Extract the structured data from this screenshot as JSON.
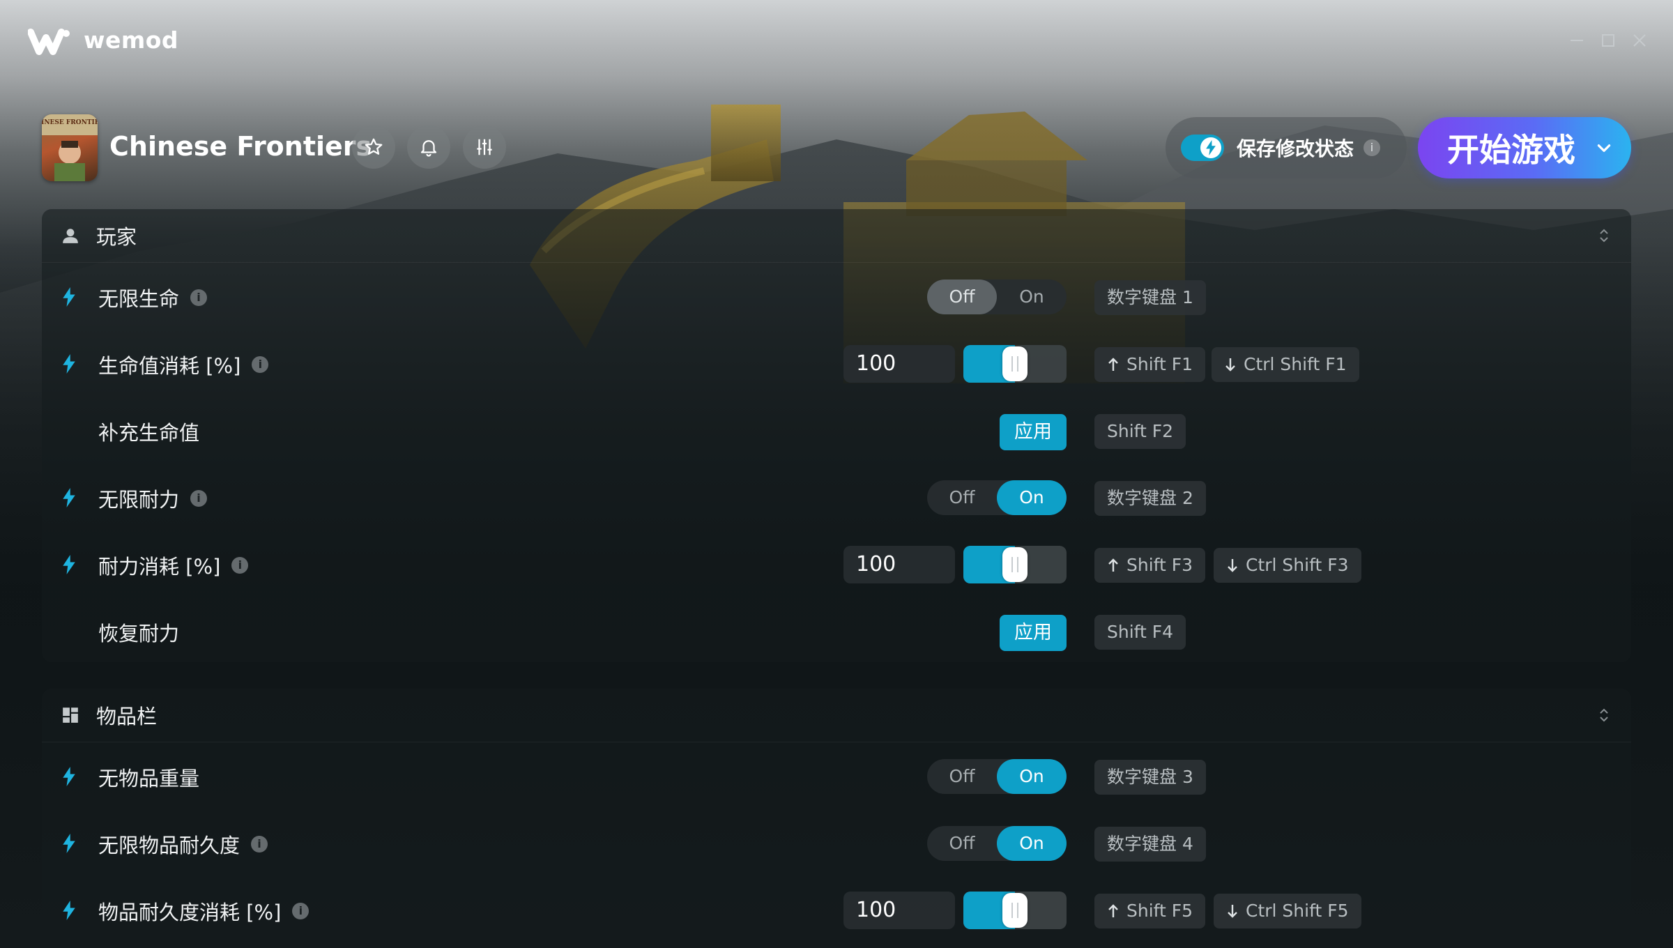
{
  "app": {
    "brand": "wemod"
  },
  "window_controls": [
    "minimize-icon",
    "maximize-icon",
    "close-icon"
  ],
  "game": {
    "title": "Chinese Frontiers",
    "thumbnail_text": "CHINESE FRONTIERS"
  },
  "header": {
    "save_mods_label": "保存修改状态",
    "save_mods_enabled": true,
    "info_glyph": "i",
    "play_label": "开始游戏"
  },
  "colors": {
    "accent": "#0ea0c8",
    "play_start": "#7b45f0",
    "play_end": "#2bb3f0"
  },
  "sections": [
    {
      "title": "玩家",
      "icon": "user-icon",
      "cheats": [
        {
          "name": "无限生命",
          "type": "toggle",
          "info": true,
          "off": "Off",
          "on": "On",
          "state": "off",
          "keys": [
            "数字键盘 1"
          ]
        },
        {
          "name": "生命值消耗 [%]",
          "type": "slider",
          "info": true,
          "value": "100",
          "fill_percent": 50,
          "keys_up": "Shift F1",
          "keys_down": "Ctrl Shift F1"
        },
        {
          "name": "补充生命值",
          "type": "button",
          "info": false,
          "button": "应用",
          "keys": [
            "Shift F2"
          ]
        },
        {
          "name": "无限耐力",
          "type": "toggle",
          "info": true,
          "off": "Off",
          "on": "On",
          "state": "on",
          "keys": [
            "数字键盘 2"
          ]
        },
        {
          "name": "耐力消耗 [%]",
          "type": "slider",
          "info": true,
          "value": "100",
          "fill_percent": 50,
          "keys_up": "Shift F3",
          "keys_down": "Ctrl Shift F3"
        },
        {
          "name": "恢复耐力",
          "type": "button",
          "info": false,
          "button": "应用",
          "keys": [
            "Shift F4"
          ]
        }
      ]
    },
    {
      "title": "物品栏",
      "icon": "inventory-grid-icon",
      "cheats": [
        {
          "name": "无物品重量",
          "type": "toggle",
          "info": false,
          "off": "Off",
          "on": "On",
          "state": "on",
          "keys": [
            "数字键盘 3"
          ]
        },
        {
          "name": "无限物品耐久度",
          "type": "toggle",
          "info": true,
          "off": "Off",
          "on": "On",
          "state": "on",
          "keys": [
            "数字键盘 4"
          ]
        },
        {
          "name": "物品耐久度消耗 [%]",
          "type": "slider",
          "info": true,
          "value": "100",
          "fill_percent": 50,
          "keys_up": "Shift F5",
          "keys_down": "Ctrl Shift F5"
        }
      ]
    }
  ]
}
